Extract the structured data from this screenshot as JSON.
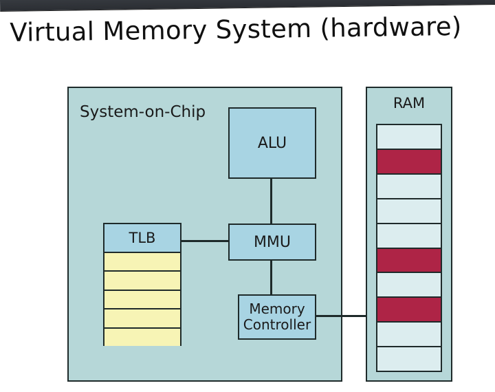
{
  "title": "Virtual Memory System (hardware)",
  "soc": {
    "label": "System-on-Chip",
    "alu": {
      "label": "ALU"
    },
    "mmu": {
      "label": "MMU"
    },
    "memc": {
      "label": "Memory\nController"
    },
    "tlb": {
      "label": "TLB",
      "entries": [
        "",
        "",
        "",
        "",
        ""
      ]
    },
    "connections": [
      [
        "ALU",
        "MMU"
      ],
      [
        "MMU",
        "TLB"
      ],
      [
        "MMU",
        "MemoryController"
      ],
      [
        "MemoryController",
        "RAM"
      ]
    ]
  },
  "ram": {
    "label": "RAM",
    "rows": [
      {
        "state": "free"
      },
      {
        "state": "used"
      },
      {
        "state": "free"
      },
      {
        "state": "free"
      },
      {
        "state": "free"
      },
      {
        "state": "used"
      },
      {
        "state": "free"
      },
      {
        "state": "used"
      },
      {
        "state": "free"
      },
      {
        "state": "free"
      }
    ]
  },
  "colors": {
    "panel": "#b6d7d8",
    "block": "#a8d4e3",
    "tlbRow": "#f7f4b5",
    "ramFree": "#dcedef",
    "ramUsed": "#ae2446",
    "border": "#1e2a2a"
  }
}
